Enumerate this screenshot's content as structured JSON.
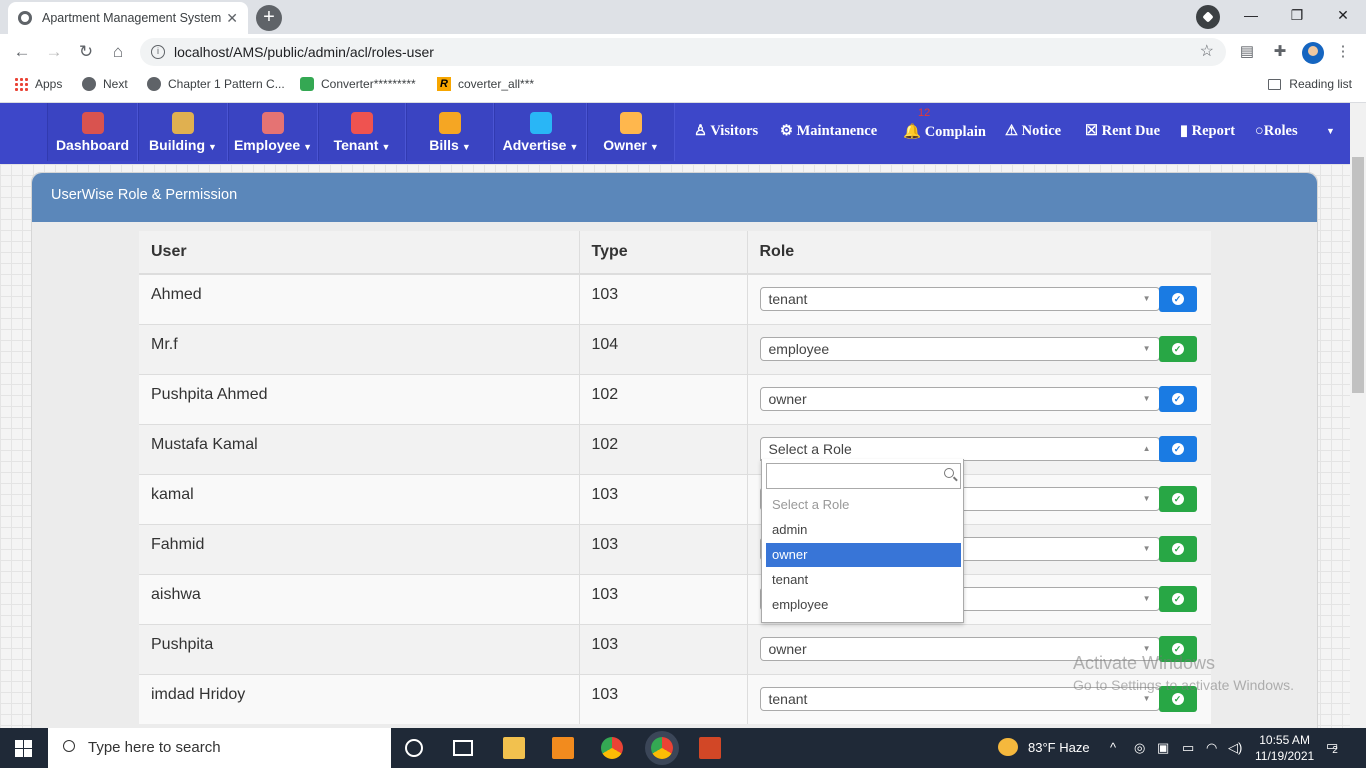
{
  "browser": {
    "tab_title": "Apartment Management System",
    "tab_close": "✕",
    "new_tab": "+",
    "url": "localhost/AMS/public/admin/acl/roles-user",
    "controls": {
      "minimize": "—",
      "restore": "❐",
      "close": "✕"
    },
    "bookmarks": [
      "Apps",
      "Next",
      "Chapter 1 Pattern C...",
      "Converter*********",
      "coverter_all***"
    ],
    "reading_list": "Reading list"
  },
  "nav": {
    "items": [
      {
        "label": "Dashboard",
        "color": "#d9534f"
      },
      {
        "label": "Building",
        "color": "#e0b050"
      },
      {
        "label": "Employee",
        "color": "#e57373"
      },
      {
        "label": "Tenant",
        "color": "#ef5350"
      },
      {
        "label": "Bills",
        "color": "#f5a623"
      },
      {
        "label": "Advertise",
        "color": "#29b6f6"
      },
      {
        "label": "Owner",
        "color": "#ffb74d"
      }
    ],
    "links": [
      "Visitors",
      "Maintanence",
      "Complain",
      "Notice",
      "Rent Due",
      "Report",
      "Roles"
    ],
    "complain_badge": "12"
  },
  "panel": {
    "title": "UserWise Role & Permission",
    "columns": [
      "User",
      "Type",
      "Role"
    ],
    "rows": [
      {
        "user": "Ahmed",
        "type": "103",
        "role": "tenant",
        "button": "blue"
      },
      {
        "user": "Mr.f",
        "type": "104",
        "role": "employee",
        "button": "green"
      },
      {
        "user": "Pushpita Ahmed",
        "type": "102",
        "role": "owner",
        "button": "blue"
      },
      {
        "user": "Mustafa Kamal",
        "type": "102",
        "role": "Select a Role",
        "button": "blue"
      },
      {
        "user": "kamal",
        "type": "103",
        "role": "",
        "button": "green"
      },
      {
        "user": "Fahmid",
        "type": "103",
        "role": "",
        "button": "green"
      },
      {
        "user": "aishwa",
        "type": "103",
        "role": "",
        "button": "green"
      },
      {
        "user": "Pushpita",
        "type": "103",
        "role": "owner",
        "button": "green"
      },
      {
        "user": "imdad Hridoy",
        "type": "103",
        "role": "tenant",
        "button": "green"
      }
    ]
  },
  "dropdown": {
    "options": [
      "Select a Role",
      "admin",
      "owner",
      "tenant",
      "employee"
    ],
    "highlighted": "owner"
  },
  "watermark": {
    "line1": "Activate Windows",
    "line2": "Go to Settings to activate Windows."
  },
  "taskbar": {
    "search_placeholder": "Type here to search",
    "weather": "83°F  Haze",
    "time": "10:55 AM",
    "date": "11/19/2021",
    "notifications": "2"
  }
}
